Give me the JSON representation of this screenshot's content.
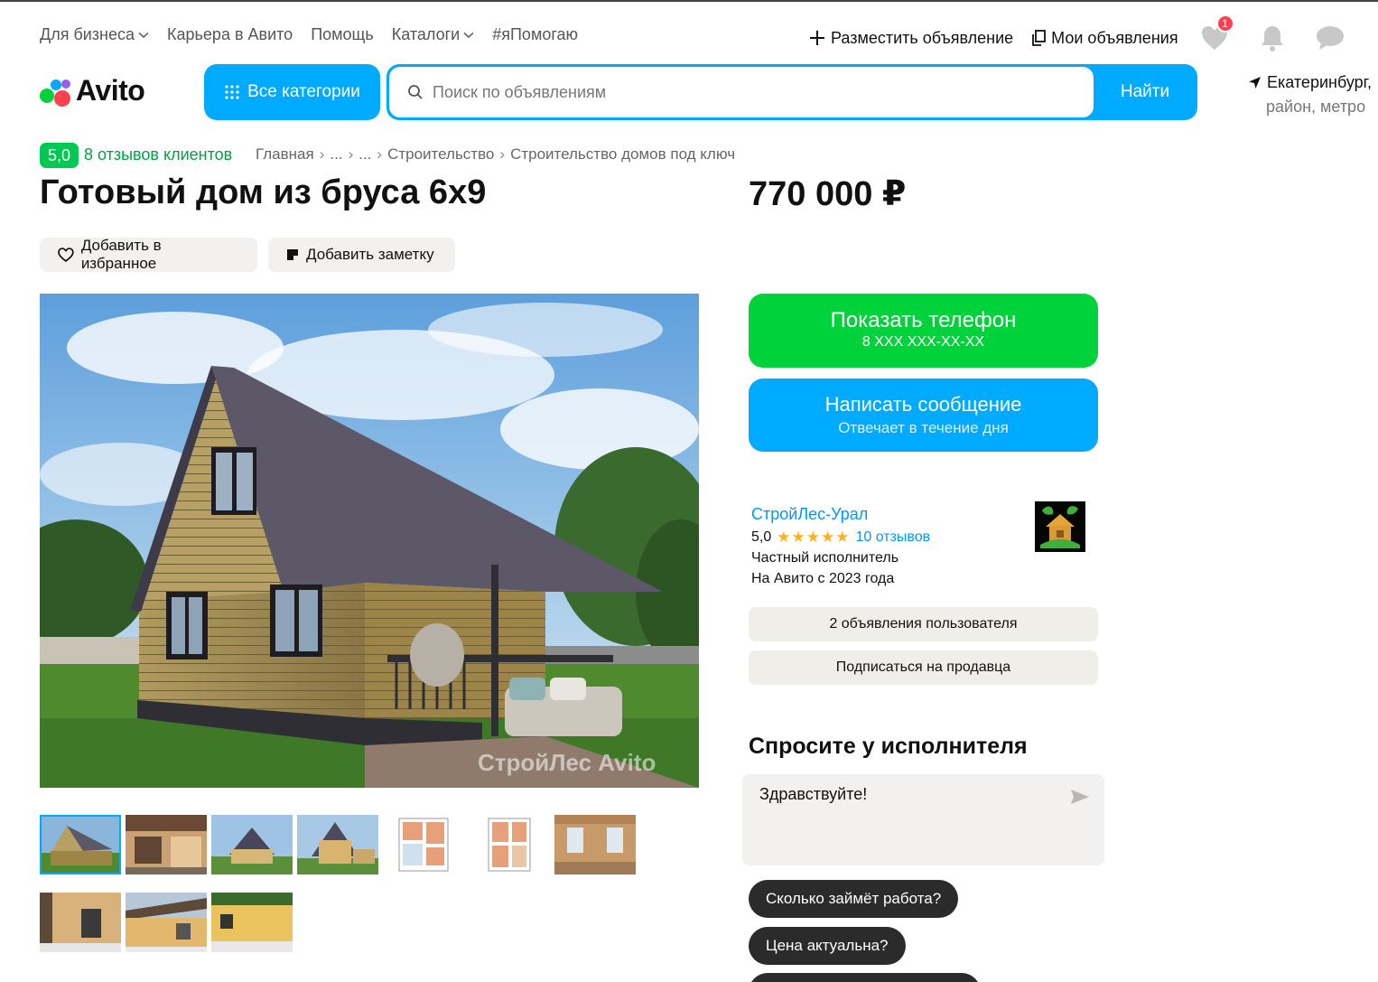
{
  "topnav": {
    "items": [
      {
        "label": "Для бизнеса",
        "has_dropdown": true
      },
      {
        "label": "Карьера в Авито",
        "has_dropdown": false
      },
      {
        "label": "Помощь",
        "has_dropdown": false
      },
      {
        "label": "Каталоги",
        "has_dropdown": true
      },
      {
        "label": "#яПомогаю",
        "has_dropdown": false
      }
    ],
    "post_ad": "Разместить объявление",
    "my_ads": "Мои объявления",
    "favorites_badge": "1"
  },
  "header": {
    "logo_text": "Avito",
    "categories_button": "Все категории",
    "search_placeholder": "Поиск по объявлениям",
    "search_button": "Найти",
    "location_line1": "Екатеринбург,",
    "location_line2": "район, метро"
  },
  "breadcrumb": {
    "rating": "5,0",
    "reviews": "8 отзывов клиентов",
    "items": [
      "Главная",
      "...",
      "...",
      "Строительство",
      "Строительство домов под ключ"
    ]
  },
  "listing": {
    "title": "Готовый дом из бруса 6х9",
    "price": "770 000 ₽",
    "add_favorite": "Добавить в избранное",
    "add_note": "Добавить заметку",
    "photo_watermark": "СтройЛес Avito"
  },
  "actions": {
    "show_phone": "Показать телефон",
    "phone_mask": "8 XXX XXX-XX-XX",
    "write_message": "Написать сообщение",
    "reply_time": "Отвечает в течение дня"
  },
  "seller": {
    "name": "СтройЛес-Урал",
    "rating": "5,0",
    "stars": "★★★★★",
    "reviews": "10 отзывов",
    "type": "Частный исполнитель",
    "since": "На Авито с 2023 года",
    "ads_count_button": "2 объявления пользователя",
    "subscribe_button": "Подписаться на продавца"
  },
  "ask": {
    "title": "Спросите у исполнителя",
    "message": "Здравствуйте!",
    "quick_questions": [
      "Сколько займёт работа?",
      "Цена актуальна?"
    ]
  },
  "colors": {
    "accent_blue": "#00aaff",
    "phone_green": "#00d23c",
    "rating_green": "#00c853",
    "link_blue": "#0099f7",
    "star_yellow": "#ffb021"
  },
  "icons": [
    "chevron-down-icon",
    "plus-icon",
    "copy-icon",
    "heart-icon",
    "bell-icon",
    "chat-icon",
    "grid-dots-icon",
    "search-icon",
    "location-arrow-icon",
    "note-icon",
    "send-icon"
  ]
}
